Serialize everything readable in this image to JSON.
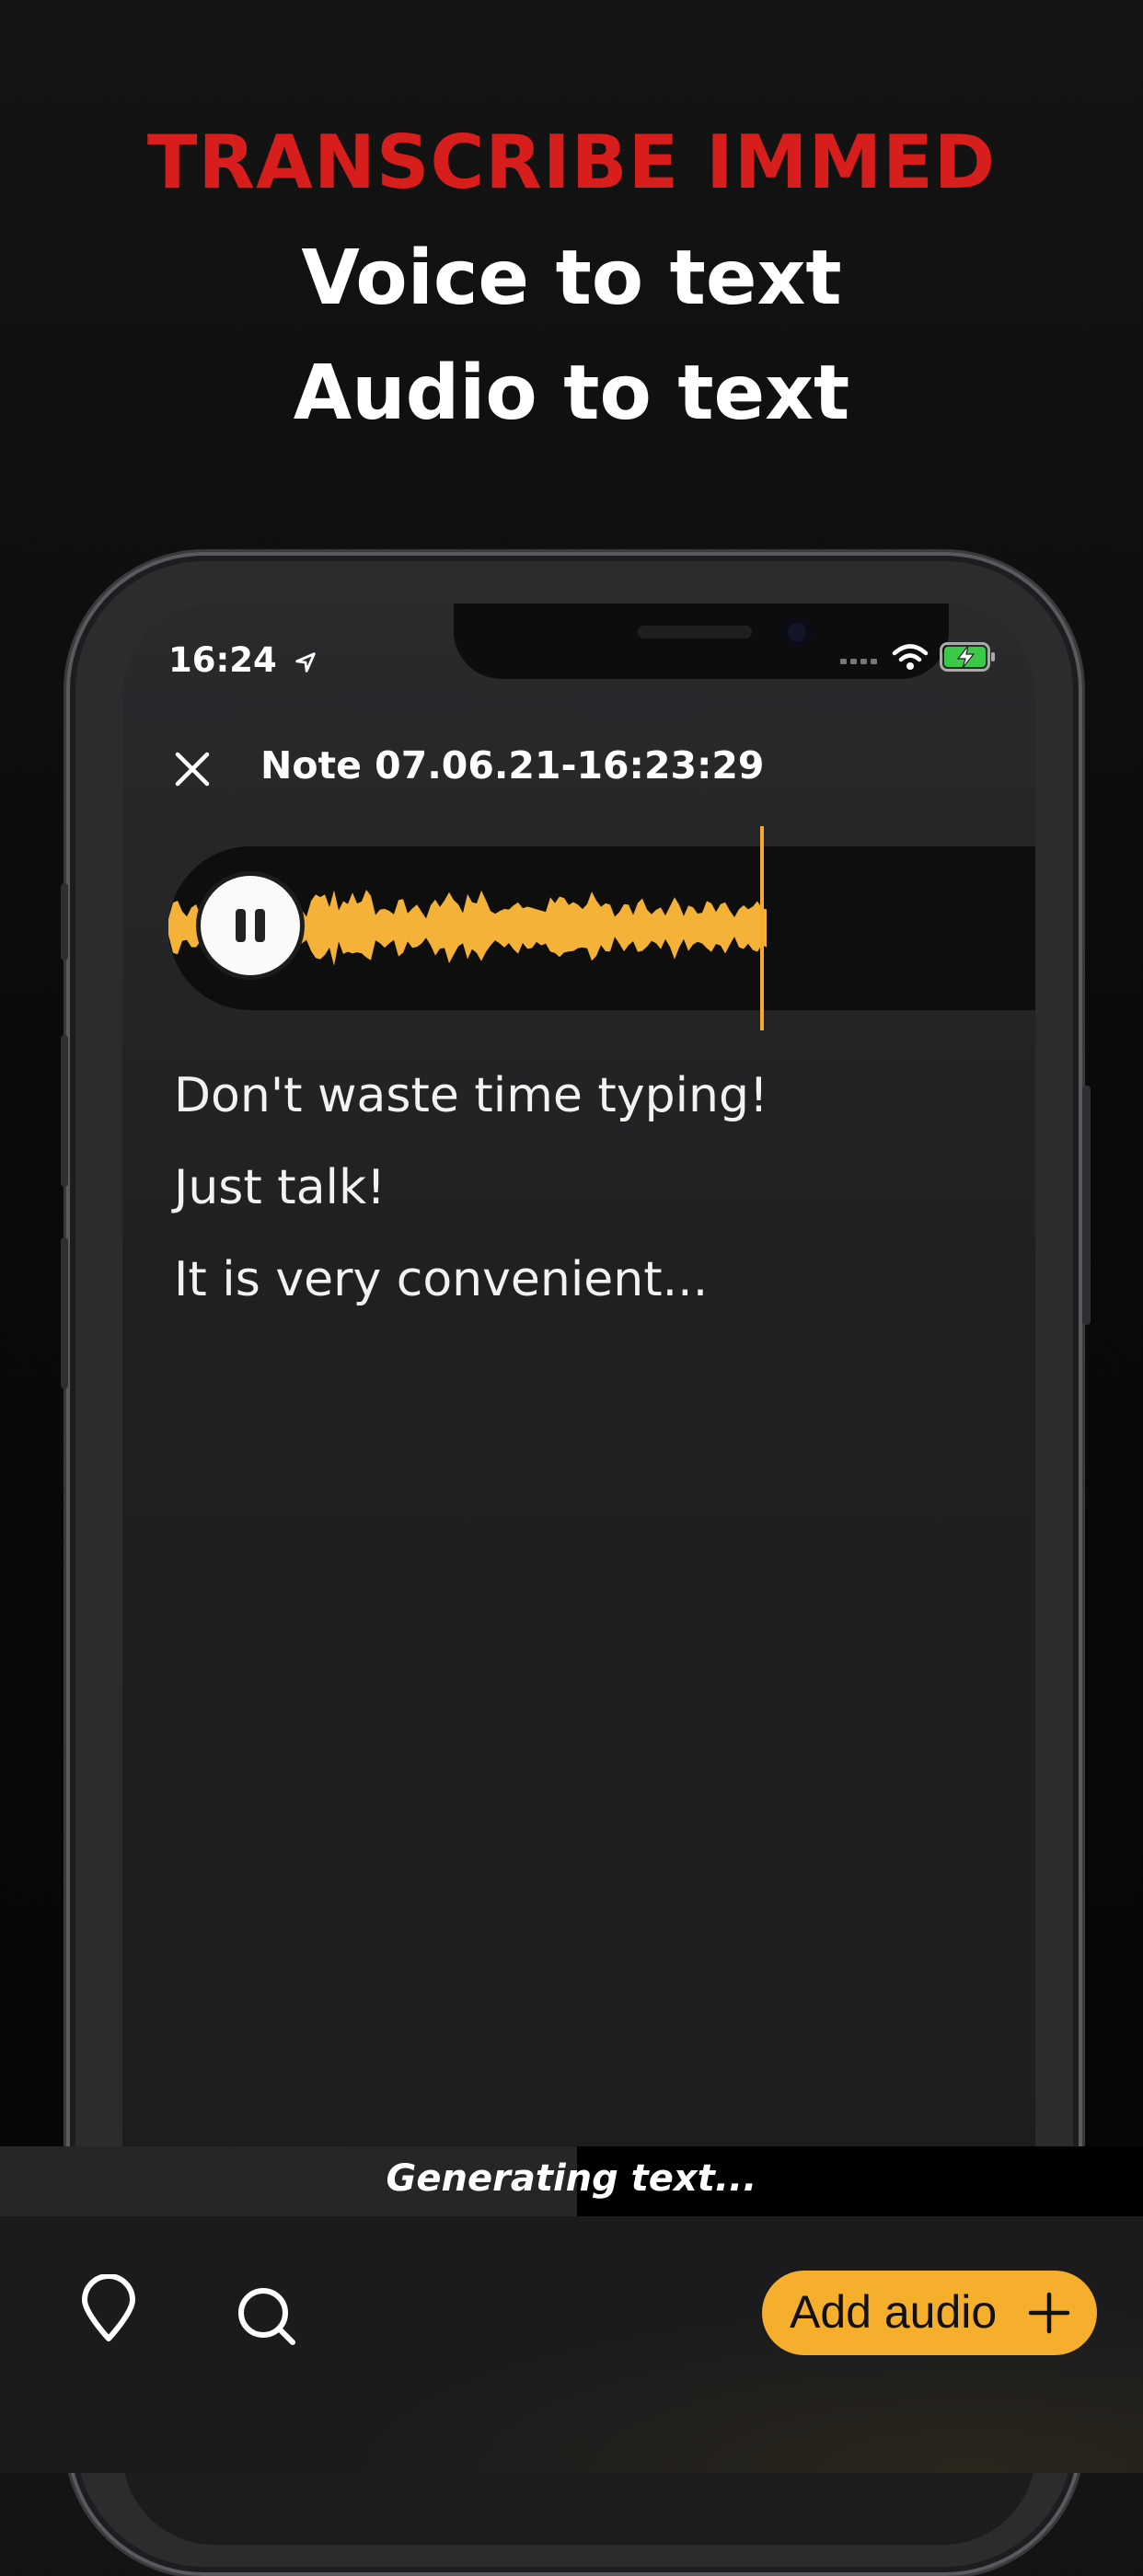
{
  "promo": {
    "headline": "TRANSCRIBE IMMED",
    "line1": "Voice to text",
    "line2": "Audio to text"
  },
  "status_bar": {
    "time": "16:24",
    "icons": [
      "location-arrow-icon",
      "signal-icon",
      "wifi-icon",
      "battery-charging-icon"
    ]
  },
  "note": {
    "title": "Note 07.06.21-16:23:29",
    "close_icon": "close-icon"
  },
  "player": {
    "state_icon": "pause-icon",
    "waveform_color": "#f5b238"
  },
  "transcript": {
    "lines": [
      "Don't waste time typing!",
      "Just talk!",
      "It is very convenient..."
    ]
  },
  "generating": {
    "label": "Generating text...",
    "progress": 0.505
  },
  "tabbar": {
    "pin_icon": "location-pin-icon",
    "search_icon": "search-icon",
    "add_label": "Add audio",
    "add_icon": "plus-icon"
  },
  "colors": {
    "accent": "#f6ae2d",
    "headline_red": "#d81d1d"
  }
}
